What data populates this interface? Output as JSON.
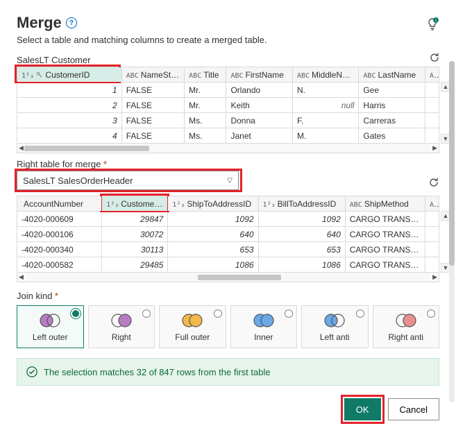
{
  "header": {
    "title": "Merge",
    "subtitle": "Select a table and matching columns to create a merged table."
  },
  "table1": {
    "name": "SalesLT Customer",
    "columns": [
      {
        "type": "1²₃",
        "icon": "key",
        "name": "CustomerID",
        "selected": true
      },
      {
        "type": "ABC",
        "name": "NameStyle"
      },
      {
        "type": "ABC",
        "name": "Title"
      },
      {
        "type": "ABC",
        "name": "FirstName"
      },
      {
        "type": "ABC",
        "name": "MiddleName"
      },
      {
        "type": "ABC",
        "name": "LastName"
      },
      {
        "type": "ABC",
        "name": ""
      }
    ],
    "rows": [
      {
        "id": "1",
        "ns": "FALSE",
        "title": "Mr.",
        "fn": "Orlando",
        "mn": "N.",
        "ln": "Gee"
      },
      {
        "id": "2",
        "ns": "FALSE",
        "title": "Mr.",
        "fn": "Keith",
        "mn_null": true,
        "ln": "Harris"
      },
      {
        "id": "3",
        "ns": "FALSE",
        "title": "Ms.",
        "fn": "Donna",
        "mn": "F.",
        "ln": "Carreras"
      },
      {
        "id": "4",
        "ns": "FALSE",
        "title": "Ms.",
        "fn": "Janet",
        "mn": "M.",
        "ln": "Gates"
      }
    ]
  },
  "right_table_label": "Right table for merge",
  "dropdown_value": "SalesLT SalesOrderHeader",
  "table2": {
    "columns": [
      {
        "type": "",
        "name": "AccountNumber"
      },
      {
        "type": "1²₃",
        "name": "CustomerID",
        "selected": true
      },
      {
        "type": "1²₃",
        "name": "ShipToAddressID"
      },
      {
        "type": "1²₃",
        "name": "BillToAddressID"
      },
      {
        "type": "ABC",
        "name": "ShipMethod"
      },
      {
        "type": "ABC",
        "name": ""
      }
    ],
    "rows": [
      {
        "acc": "-4020-000609",
        "cid": "29847",
        "ship": "1092",
        "bill": "1092",
        "sm": "CARGO TRANSPO…"
      },
      {
        "acc": "-4020-000106",
        "cid": "30072",
        "ship": "640",
        "bill": "640",
        "sm": "CARGO TRANSPO…"
      },
      {
        "acc": "-4020-000340",
        "cid": "30113",
        "ship": "653",
        "bill": "653",
        "sm": "CARGO TRANSPO…"
      },
      {
        "acc": "-4020-000582",
        "cid": "29485",
        "ship": "1086",
        "bill": "1086",
        "sm": "CARGO TRANSPO…"
      }
    ]
  },
  "join": {
    "label": "Join kind",
    "options": [
      {
        "name": "Left outer",
        "fill": "left",
        "c1": "#b77dc4",
        "c2": "none"
      },
      {
        "name": "Right",
        "fill": "right",
        "c1": "none",
        "c2": "#b77dc4"
      },
      {
        "name": "Full outer",
        "fill": "both",
        "c1": "#f2b84b",
        "c2": "#f2b84b"
      },
      {
        "name": "Inner",
        "fill": "inter",
        "c1": "#6aa8e8",
        "c2": "#6aa8e8"
      },
      {
        "name": "Left anti",
        "fill": "lanti",
        "c1": "#6aa8e8",
        "c2": "none"
      },
      {
        "name": "Right anti",
        "fill": "ranti",
        "c1": "none",
        "c2": "#e98f8f"
      }
    ],
    "selected": 0
  },
  "status_text": "The selection matches 32 of 847 rows from the first table",
  "buttons": {
    "ok": "OK",
    "cancel": "Cancel"
  },
  "null_text": "null"
}
